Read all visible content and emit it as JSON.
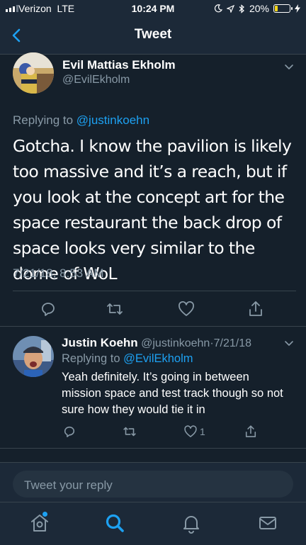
{
  "status_bar": {
    "carrier": "Verizon",
    "network": "LTE",
    "time": "10:24 PM",
    "battery_percent": "20%",
    "battery_level": 0.2,
    "battery_color": "#f5d515"
  },
  "nav": {
    "title": "Tweet",
    "back_icon": "chevron-left-icon"
  },
  "tweet": {
    "author_name": "Evil Mattias Ekholm",
    "author_handle": "@EvilEkholm",
    "replying_to_prefix": "Replying to",
    "replying_to_handle": "@justinkoehn",
    "text": "Gotcha. I know the pavilion is likely too massive and it’s a reach, but if you look at the concept art for the space restaurant the back drop of space looks very similar to the dome of WoL",
    "timestamp": "7/21/18, 8:53 AM"
  },
  "reply": {
    "author_name": "Justin Koehn",
    "author_handle": "@justinkoehn",
    "separator": "·",
    "date": "7/21/18",
    "replying_to_prefix": "Replying to",
    "replying_to_handle": "@EvilEkholm",
    "text": "Yeah definitely. It’s going in between mission space and test track though so not sure how they would tie it in",
    "like_count": "1"
  },
  "composer": {
    "placeholder": "Tweet your reply"
  },
  "colors": {
    "background": "#15202b",
    "bar": "#1c2938",
    "accent": "#1da1f2",
    "muted": "#8899a6",
    "divider": "#38444d"
  }
}
